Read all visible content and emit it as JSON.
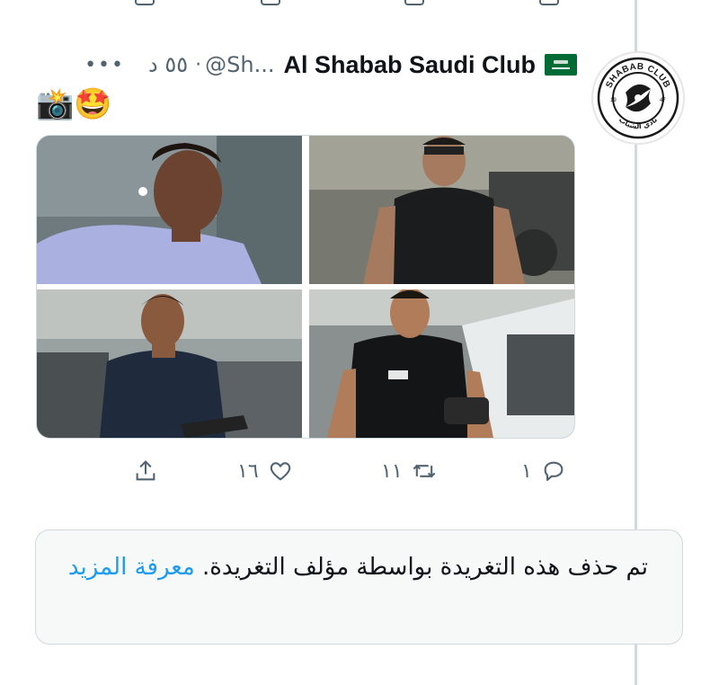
{
  "tweet": {
    "display_name": "Al Shabab Saudi Club",
    "handle": "@Sh...",
    "separator": "·",
    "time": "٥٥ د",
    "more_label": "•••",
    "text": "📸🤩",
    "avatar": {
      "top_text": "SHABAB CLUB",
      "year_left": "19",
      "year_right": "47",
      "bottom_text": "نادي الشباب"
    },
    "images": [
      {
        "alt": "player in lavender t-shirt smiling"
      },
      {
        "alt": "player in black tank top with sunglasses"
      },
      {
        "alt": "player in navy t-shirt"
      },
      {
        "alt": "player in black sleeveless shirt with bag"
      }
    ],
    "actions": {
      "replies": "١",
      "retweets": "١١",
      "likes": "١٦"
    }
  },
  "notice": {
    "text": "تم حذف هذه التغريدة بواسطة مؤلف التغريدة.",
    "learn_more": "معرفة المزيد"
  },
  "colors": {
    "accent": "#1d9bf0",
    "muted": "#536471",
    "border": "#cfd9de",
    "flag_green": "#006c35"
  }
}
